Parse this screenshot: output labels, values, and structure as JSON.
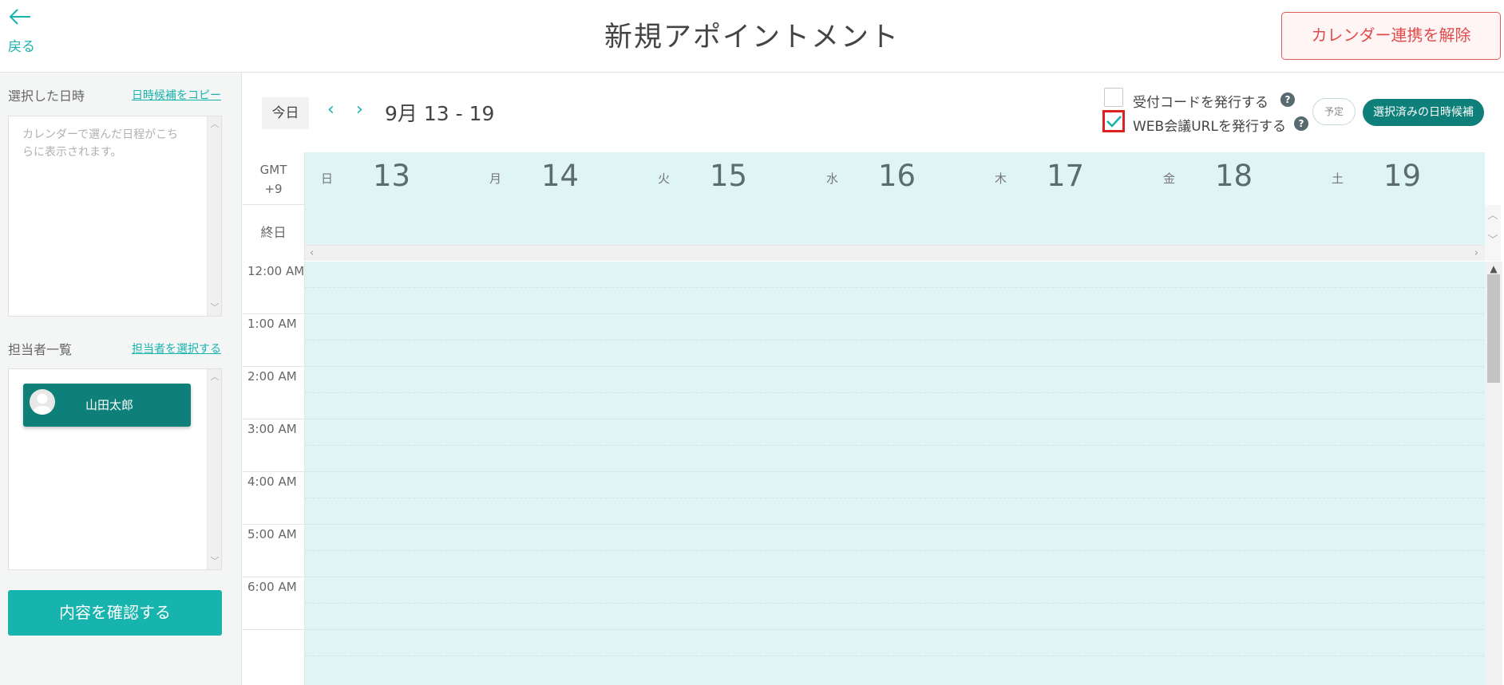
{
  "header": {
    "back_label": "戻る",
    "title": "新規アポイントメント",
    "unlink_button": "カレンダー連携を解除"
  },
  "left_panel": {
    "selected_datetime": {
      "title": "選択した日時",
      "copy_link": "日時候補をコピー",
      "placeholder": "カレンダーで選んだ日程がこちらに表示されます。"
    },
    "staff": {
      "title": "担当者一覧",
      "select_link": "担当者を選択する",
      "members": [
        "山田太郎"
      ]
    },
    "confirm_button": "内容を確認する"
  },
  "calendar": {
    "today_button": "今日",
    "range": "9月 13 - 19",
    "options": {
      "reception_code": {
        "label": "受付コードを発行する",
        "checked": false
      },
      "web_meeting_url": {
        "label": "WEB会議URLを発行する",
        "checked": true
      }
    },
    "schedule_button": "予定",
    "selected_candidates_button": "選択済みの日時候補",
    "timezone_line1": "GMT",
    "timezone_line2": "+9",
    "allday_label": "終日",
    "days": [
      {
        "dow": "日",
        "num": "13"
      },
      {
        "dow": "月",
        "num": "14"
      },
      {
        "dow": "火",
        "num": "15"
      },
      {
        "dow": "水",
        "num": "16"
      },
      {
        "dow": "木",
        "num": "17"
      },
      {
        "dow": "金",
        "num": "18"
      },
      {
        "dow": "土",
        "num": "19"
      }
    ],
    "times": [
      "12:00 AM",
      "1:00 AM",
      "2:00 AM",
      "3:00 AM",
      "4:00 AM",
      "5:00 AM",
      "6:00 AM"
    ]
  },
  "colors": {
    "accent": "#17b3ad",
    "dark_teal": "#0e8079",
    "danger": "#e04c4c",
    "calendar_bg": "#dff4f5"
  }
}
